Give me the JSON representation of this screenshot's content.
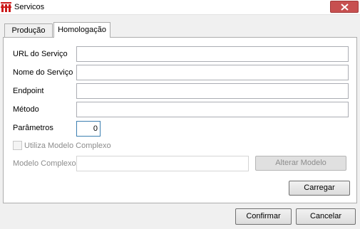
{
  "window": {
    "title": "Servicos",
    "icon": "app-logo-icon",
    "close_icon": "close-icon"
  },
  "tabs": [
    {
      "label": "Produção",
      "active": false
    },
    {
      "label": "Homologação",
      "active": true
    }
  ],
  "form": {
    "url_label": "URL do Serviço",
    "url_value": "",
    "nome_label": "Nome do Serviço",
    "nome_value": "",
    "endpoint_label": "Endpoint",
    "endpoint_value": "",
    "metodo_label": "Método",
    "metodo_value": "",
    "parametros_label": "Parâmetros",
    "parametros_value": "0",
    "complex_checkbox_label": "Utiliza Modelo Complexo",
    "modelo_label": "Modelo Complexo",
    "modelo_value": "",
    "alterar_button": "Alterar Modelo",
    "carregar_button": "Carregar"
  },
  "footer": {
    "confirm_button": "Confirmar",
    "cancel_button": "Cancelar"
  },
  "colors": {
    "close_button": "#c75050",
    "app_icon": "#cc1b1b"
  }
}
